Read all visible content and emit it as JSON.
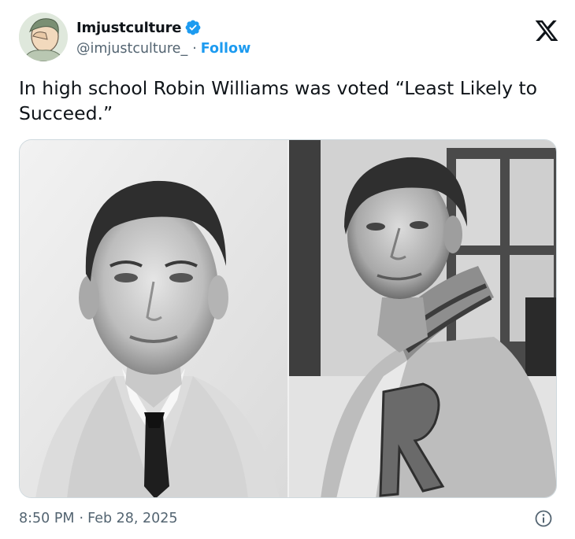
{
  "author": {
    "name": "Imjustculture",
    "handle": "@imjustculture_",
    "separator": "·",
    "follow_label": "Follow",
    "verified_color": "#1d9bf0",
    "avatar_icon": "avatar-illustration"
  },
  "tweet": {
    "text": "In high school Robin Williams was voted “Least Likely to Succeed.”"
  },
  "media": {
    "photos": [
      {
        "icon": "portrait-photo-yearbook"
      },
      {
        "icon": "portrait-photo-letterman-jacket"
      }
    ]
  },
  "footer": {
    "time": "8:50 PM",
    "separator": "·",
    "date": "Feb 28, 2025"
  },
  "colors": {
    "text": "#0f1419",
    "muted": "#536471",
    "accent": "#1d9bf0",
    "border": "#cfd9de"
  }
}
